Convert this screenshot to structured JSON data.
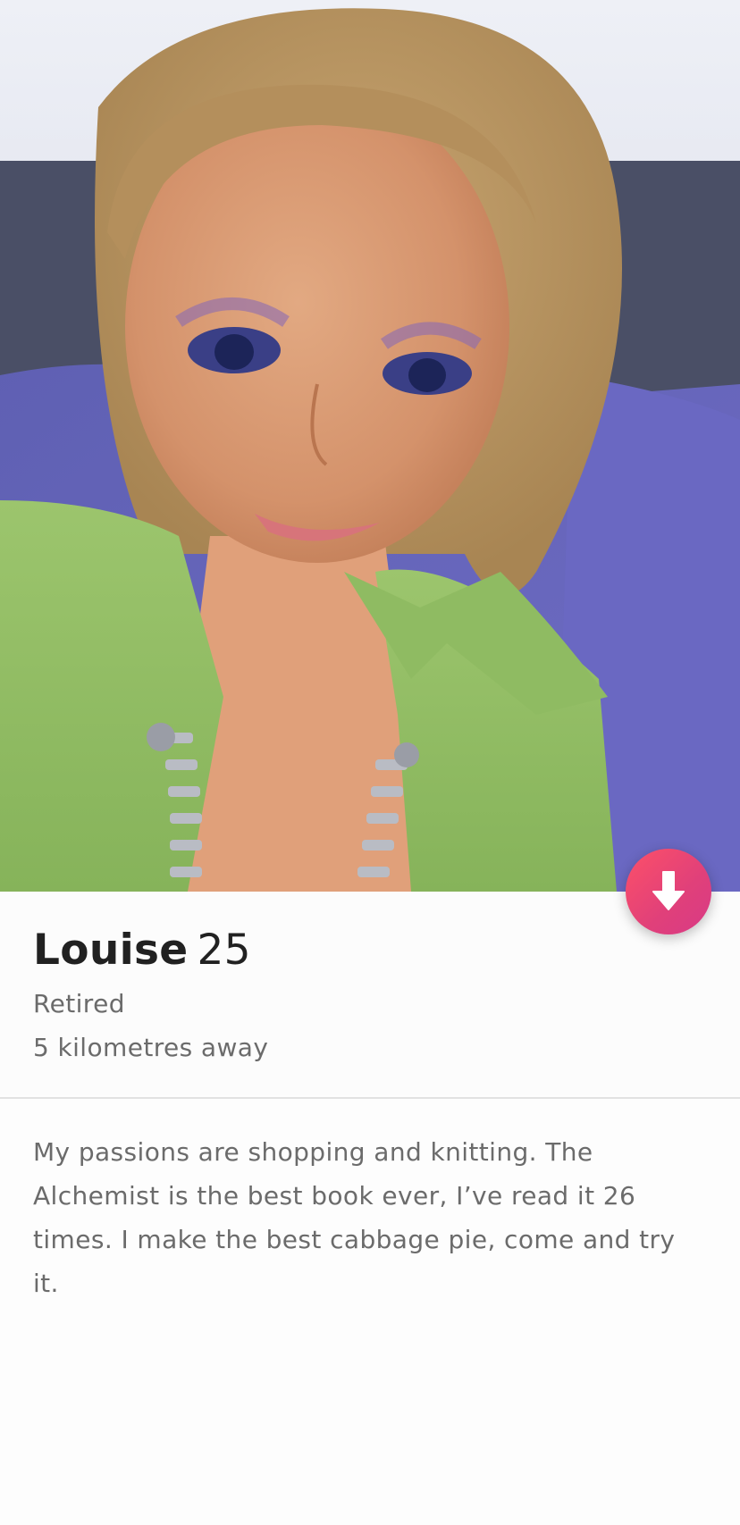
{
  "profile": {
    "name": "Louise",
    "age": "25",
    "job": "Retired",
    "distance": "5 kilometres away",
    "bio_lines": [
      "My passions are shopping and knitting. The",
      "Alchemist is the best book ever, I’ve read it 26",
      "times. I make the best cabbage pie, come and try",
      "it."
    ]
  },
  "icons": {
    "collapse": "arrow-down-icon"
  },
  "colors": {
    "accent": "#fd5068",
    "name_text": "#212121",
    "secondary_text": "#6b6b6b"
  }
}
